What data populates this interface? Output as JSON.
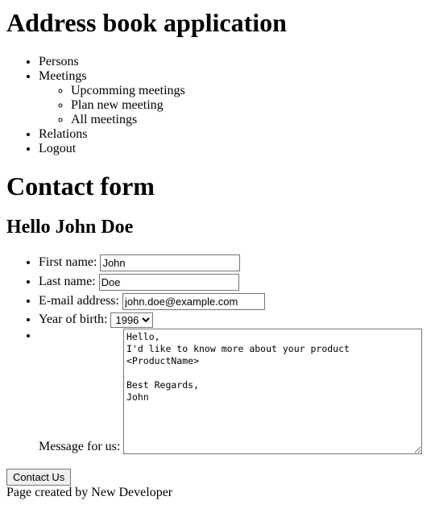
{
  "app": {
    "title": "Address book application"
  },
  "nav": {
    "items": [
      {
        "label": "Persons"
      },
      {
        "label": "Meetings",
        "children": [
          {
            "label": "Upcomming meetings"
          },
          {
            "label": "Plan new meeting"
          },
          {
            "label": "All meetings"
          }
        ]
      },
      {
        "label": "Relations"
      },
      {
        "label": "Logout"
      }
    ]
  },
  "form": {
    "title": "Contact form",
    "greeting": "Hello John Doe",
    "first_name": {
      "label": "First name:",
      "value": "John"
    },
    "last_name": {
      "label": "Last name:",
      "value": "Doe"
    },
    "email": {
      "label": "E-mail address:",
      "value": "john.doe@example.com"
    },
    "year_of_birth": {
      "label": "Year of birth:",
      "selected": "1996"
    },
    "message": {
      "label": "Message for us:",
      "value": "Hello,\nI'd like to know more about your product\n<ProductName>\n\nBest Regards,\nJohn"
    },
    "submit_label": "Contact Us"
  },
  "footer": {
    "text": "Page created by New Developer"
  }
}
